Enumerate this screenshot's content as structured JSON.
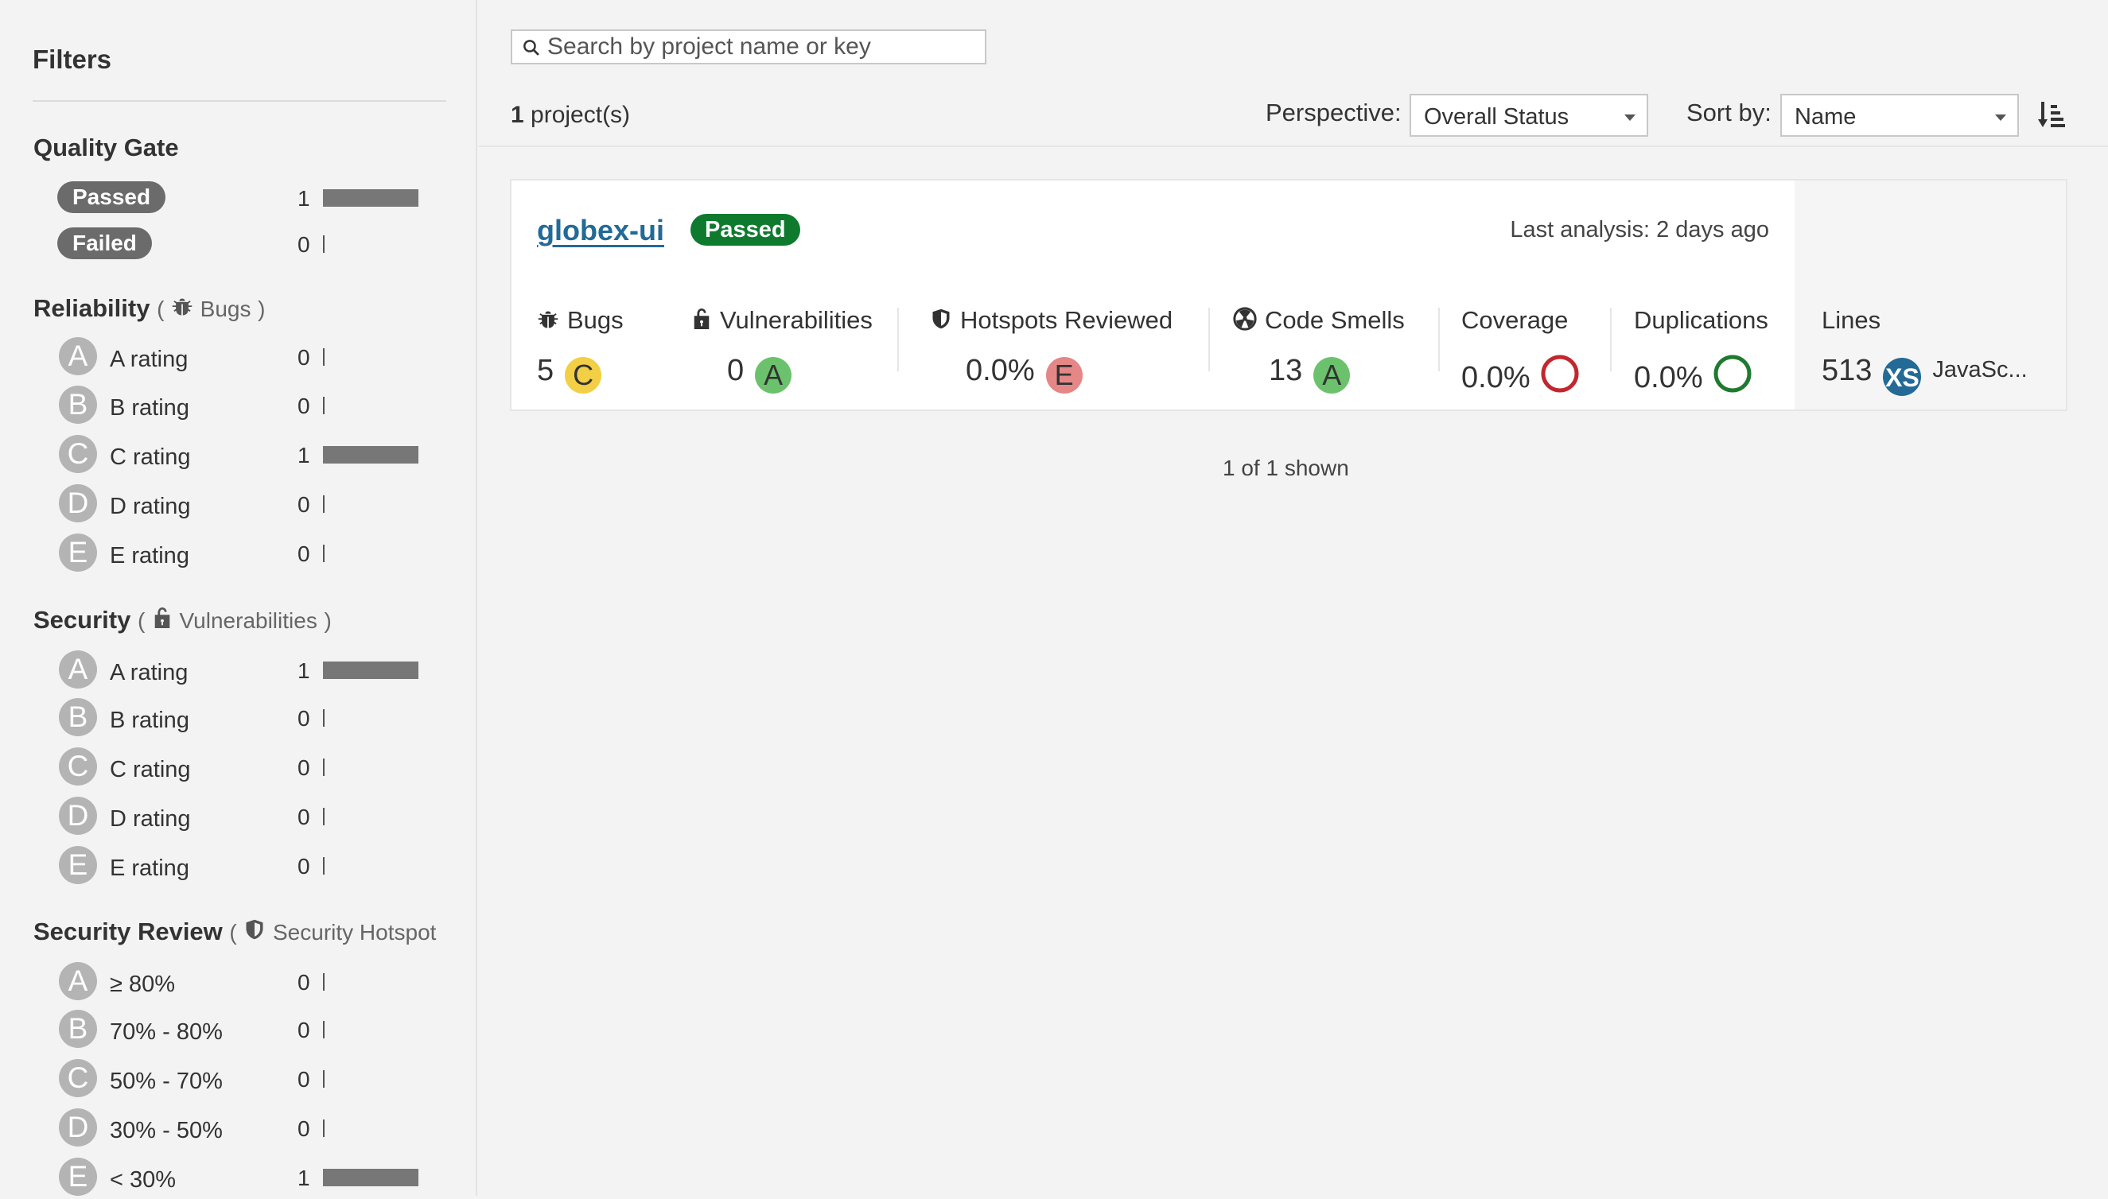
{
  "sidebar": {
    "title": "Filters",
    "quality_gate": {
      "title": "Quality Gate",
      "items": [
        {
          "label": "Passed",
          "count": "1",
          "fraction": 1
        },
        {
          "label": "Failed",
          "count": "0",
          "fraction": 0
        }
      ]
    },
    "reliability": {
      "title": "Reliability",
      "open": "(",
      "sub": "Bugs",
      "close": ")",
      "icon": "bug-icon",
      "items": [
        {
          "grade": "A",
          "label": "A rating",
          "count": "0",
          "fraction": 0
        },
        {
          "grade": "B",
          "label": "B rating",
          "count": "0",
          "fraction": 0
        },
        {
          "grade": "C",
          "label": "C rating",
          "count": "1",
          "fraction": 1
        },
        {
          "grade": "D",
          "label": "D rating",
          "count": "0",
          "fraction": 0
        },
        {
          "grade": "E",
          "label": "E rating",
          "count": "0",
          "fraction": 0
        }
      ]
    },
    "security": {
      "title": "Security",
      "open": "(",
      "sub": "Vulnerabilities",
      "close": ")",
      "icon": "unlock-icon",
      "items": [
        {
          "grade": "A",
          "label": "A rating",
          "count": "1",
          "fraction": 1
        },
        {
          "grade": "B",
          "label": "B rating",
          "count": "0",
          "fraction": 0
        },
        {
          "grade": "C",
          "label": "C rating",
          "count": "0",
          "fraction": 0
        },
        {
          "grade": "D",
          "label": "D rating",
          "count": "0",
          "fraction": 0
        },
        {
          "grade": "E",
          "label": "E rating",
          "count": "0",
          "fraction": 0
        }
      ]
    },
    "security_review": {
      "title": "Security Review",
      "open": "(",
      "sub": "Security Hotspot",
      "icon": "shield-icon",
      "items": [
        {
          "grade": "A",
          "label": "≥ 80%",
          "count": "0",
          "fraction": 0
        },
        {
          "grade": "B",
          "label": "70% - 80%",
          "count": "0",
          "fraction": 0
        },
        {
          "grade": "C",
          "label": "50% - 70%",
          "count": "0",
          "fraction": 0
        },
        {
          "grade": "D",
          "label": "30% - 50%",
          "count": "0",
          "fraction": 0
        },
        {
          "grade": "E",
          "label": "< 30%",
          "count": "1",
          "fraction": 1
        }
      ]
    }
  },
  "header": {
    "search_placeholder": "Search by project name or key",
    "project_count": "1",
    "project_count_suffix": " project(s)",
    "perspective_label": "Perspective:",
    "perspective_value": "Overall Status",
    "sort_label": "Sort by:",
    "sort_value": "Name"
  },
  "project": {
    "name": "globex-ui",
    "quality_gate": "Passed",
    "last_analysis": "Last analysis: 2 days ago",
    "measures": {
      "bugs": {
        "label": "Bugs",
        "value": "5",
        "rating": "C"
      },
      "vulnerabilities": {
        "label": "Vulnerabilities",
        "value": "0",
        "rating": "A"
      },
      "hotspots": {
        "label": "Hotspots Reviewed",
        "value": "0.0%",
        "rating": "E"
      },
      "code_smells": {
        "label": "Code Smells",
        "value": "13",
        "rating": "A"
      },
      "coverage": {
        "label": "Coverage",
        "value": "0.0%"
      },
      "duplications": {
        "label": "Duplications",
        "value": "0.0%"
      },
      "lines": {
        "label": "Lines",
        "value": "513",
        "size": "XS",
        "language": "JavaSc..."
      }
    }
  },
  "footer": {
    "shown": "1 of 1 shown"
  },
  "colors": {
    "rating_A": "#6cc26c",
    "rating_C": "#f2cf45",
    "rating_E": "#e48786",
    "passed": "#0e7a2e",
    "coverage_ring": "#c1272d",
    "duplications_ring": "#1e7a2f",
    "link": "#236a97"
  }
}
